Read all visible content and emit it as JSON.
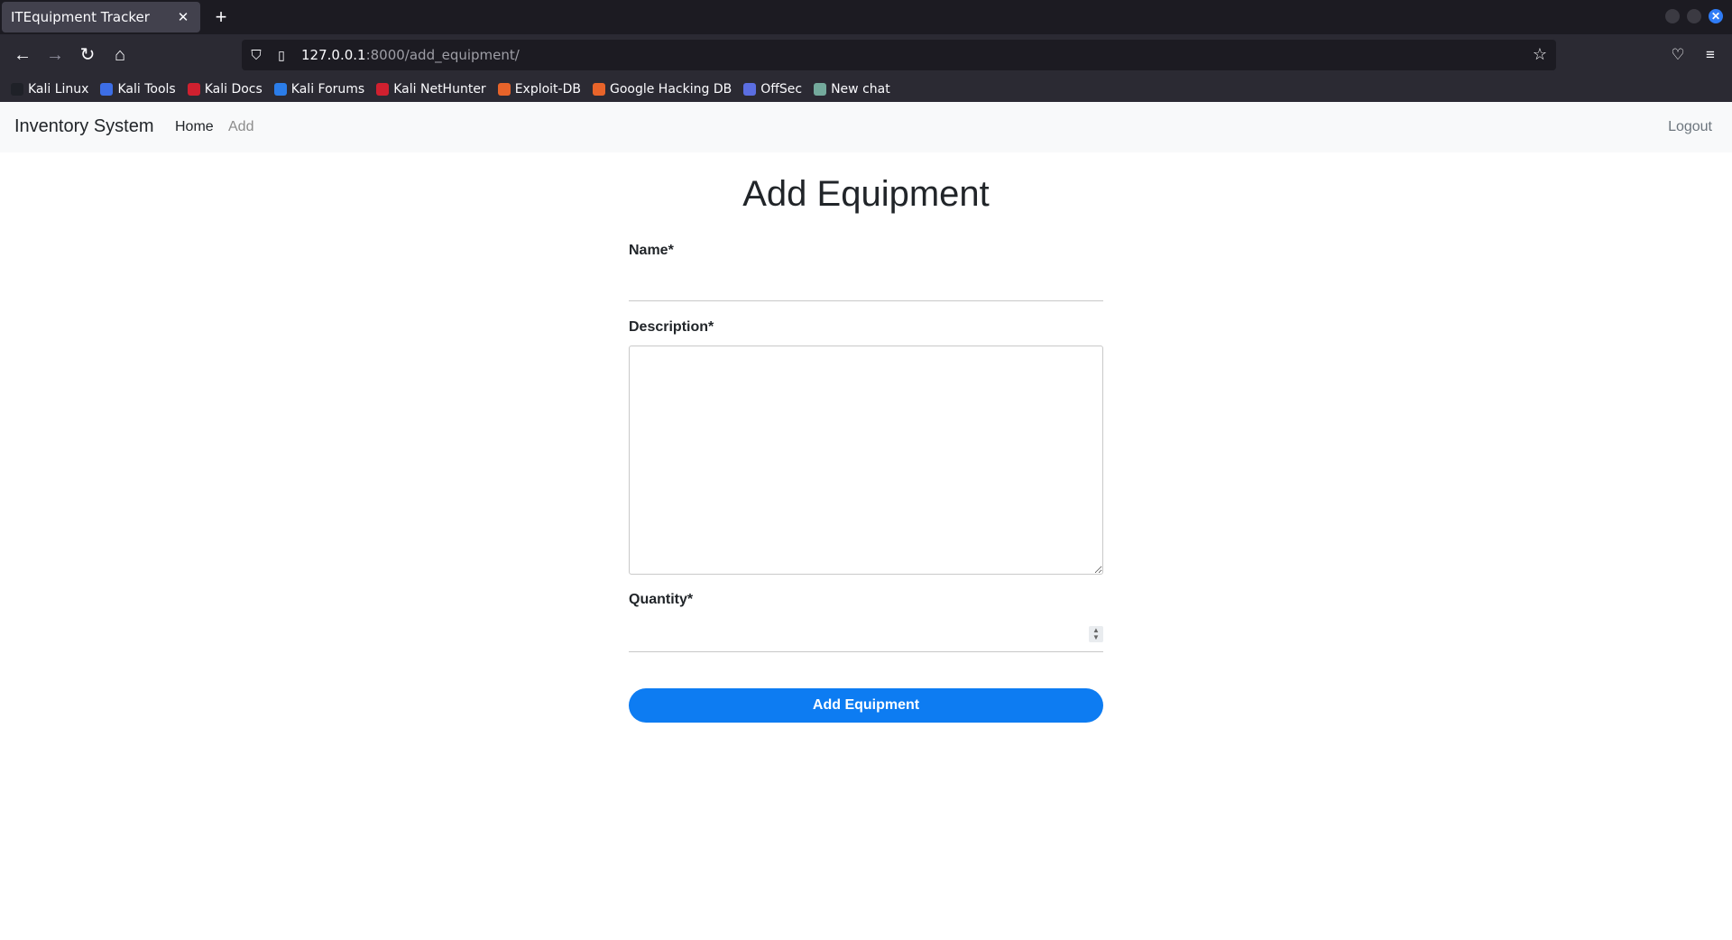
{
  "browser": {
    "tab_title": "ITEquipment Tracker",
    "tab_close": "✕",
    "new_tab": "+",
    "url_host": "127.0.0.1",
    "url_path": ":8000/add_equipment/",
    "bookmarks": [
      {
        "label": "Kali Linux",
        "icon": "kali-dragon-icon",
        "color": "#1f2128"
      },
      {
        "label": "Kali Tools",
        "icon": "kali-tools-icon",
        "color": "#3d6ee6"
      },
      {
        "label": "Kali Docs",
        "icon": "kali-docs-icon",
        "color": "#d0202f"
      },
      {
        "label": "Kali Forums",
        "icon": "kali-forums-icon",
        "color": "#2b7de9"
      },
      {
        "label": "Kali NetHunter",
        "icon": "nethunter-icon",
        "color": "#d0202f"
      },
      {
        "label": "Exploit-DB",
        "icon": "exploit-db-icon",
        "color": "#e8642a"
      },
      {
        "label": "Google Hacking DB",
        "icon": "ghdb-icon",
        "color": "#e8642a"
      },
      {
        "label": "OffSec",
        "icon": "offsec-icon",
        "color": "#5b6ee1"
      },
      {
        "label": "New chat",
        "icon": "chat-icon",
        "color": "#74aa9c"
      }
    ]
  },
  "site": {
    "brand": "Inventory System",
    "nav": {
      "home": "Home",
      "add": "Add",
      "logout": "Logout"
    }
  },
  "form": {
    "title": "Add Equipment",
    "name_label": "Name*",
    "name_value": "",
    "description_label": "Description*",
    "description_value": "",
    "quantity_label": "Quantity*",
    "quantity_value": "",
    "submit_label": "Add Equipment"
  },
  "colors": {
    "accent": "#0d7cf2",
    "navbar_bg": "#f8f9fa",
    "browser_dark": "#1c1b22"
  }
}
